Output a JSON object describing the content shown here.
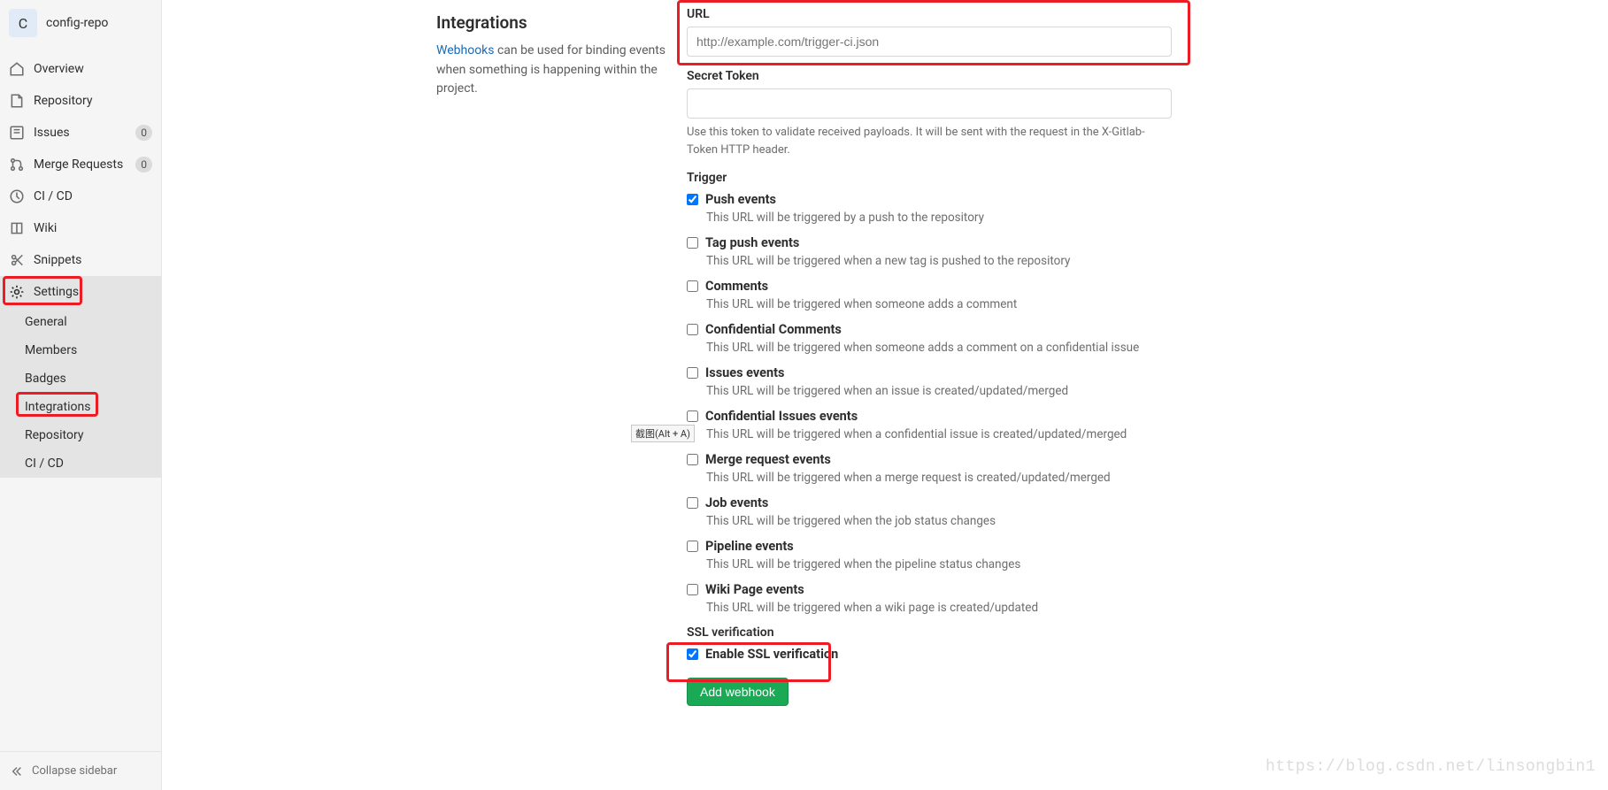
{
  "project": {
    "avatar_letter": "C",
    "name": "config-repo"
  },
  "sidebar": {
    "items": [
      {
        "label": "Overview"
      },
      {
        "label": "Repository"
      },
      {
        "label": "Issues",
        "badge": "0"
      },
      {
        "label": "Merge Requests",
        "badge": "0"
      },
      {
        "label": "CI / CD"
      },
      {
        "label": "Wiki"
      },
      {
        "label": "Snippets"
      },
      {
        "label": "Settings"
      }
    ],
    "settings_sub": [
      {
        "label": "General"
      },
      {
        "label": "Members"
      },
      {
        "label": "Badges"
      },
      {
        "label": "Integrations"
      },
      {
        "label": "Repository"
      },
      {
        "label": "CI / CD"
      }
    ],
    "collapse_label": "Collapse sidebar"
  },
  "intro": {
    "heading": "Integrations",
    "link_text": "Webhooks",
    "desc_after": " can be used for binding events when something is happening within the project."
  },
  "form": {
    "url_label": "URL",
    "url_placeholder": "http://example.com/trigger-ci.json",
    "secret_label": "Secret Token",
    "secret_help": "Use this token to validate received payloads. It will be sent with the request in the X-Gitlab-Token HTTP header.",
    "trigger_label": "Trigger",
    "triggers": [
      {
        "label": "Push events",
        "desc": "This URL will be triggered by a push to the repository",
        "checked": true
      },
      {
        "label": "Tag push events",
        "desc": "This URL will be triggered when a new tag is pushed to the repository",
        "checked": false
      },
      {
        "label": "Comments",
        "desc": "This URL will be triggered when someone adds a comment",
        "checked": false
      },
      {
        "label": "Confidential Comments",
        "desc": "This URL will be triggered when someone adds a comment on a confidential issue",
        "checked": false
      },
      {
        "label": "Issues events",
        "desc": "This URL will be triggered when an issue is created/updated/merged",
        "checked": false
      },
      {
        "label": "Confidential Issues events",
        "desc": "This URL will be triggered when a confidential issue is created/updated/merged",
        "checked": false
      },
      {
        "label": "Merge request events",
        "desc": "This URL will be triggered when a merge request is created/updated/merged",
        "checked": false
      },
      {
        "label": "Job events",
        "desc": "This URL will be triggered when the job status changes",
        "checked": false
      },
      {
        "label": "Pipeline events",
        "desc": "This URL will be triggered when the pipeline status changes",
        "checked": false
      },
      {
        "label": "Wiki Page events",
        "desc": "This URL will be triggered when a wiki page is created/updated",
        "checked": false
      }
    ],
    "ssl_section_label": "SSL verification",
    "ssl_checkbox_label": "Enable SSL verification",
    "ssl_checked": true,
    "submit_label": "Add webhook"
  },
  "tooltip": "截图(Alt + A)",
  "watermark": "https://blog.csdn.net/linsongbin1"
}
